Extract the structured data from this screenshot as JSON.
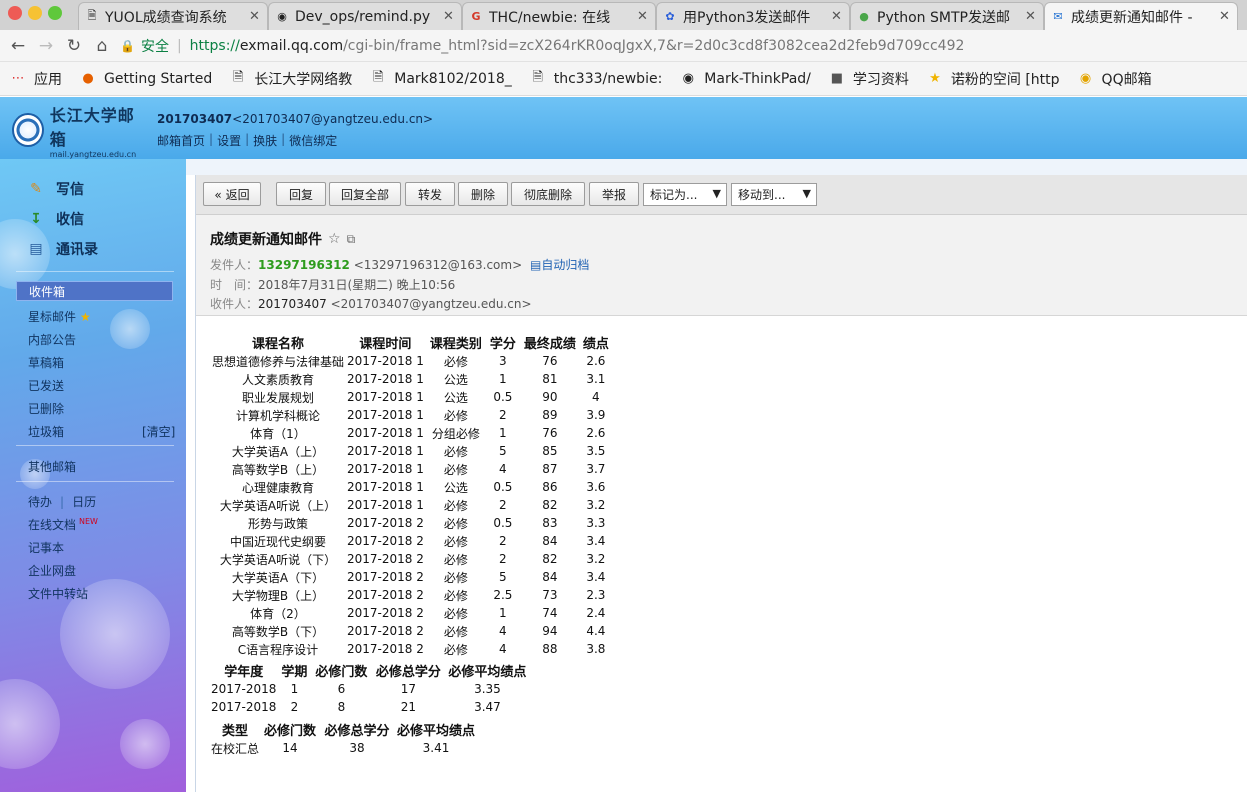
{
  "browser": {
    "tabs": [
      {
        "icon": "page-icon",
        "title": "YUOL成绩查询系统"
      },
      {
        "icon": "github-icon",
        "title": "Dev_ops/remind.py"
      },
      {
        "icon": "g-icon",
        "title": "THC/newbie: 在线"
      },
      {
        "icon": "paw-icon",
        "title": "用Python3发送邮件"
      },
      {
        "icon": "chat-icon",
        "title": "Python SMTP发送邮"
      },
      {
        "icon": "mail-icon",
        "title": "成绩更新通知邮件 -"
      }
    ],
    "address": {
      "secure_label": "安全",
      "scheme": "https://",
      "host": "exmail.qq.com",
      "path": "/cgi-bin/frame_html?sid=zcX264rKR0oqJgxX,7&r=2d0c3cd8f3082cea2d2feb9d709cc492"
    },
    "bookmarks": [
      {
        "icon": "apps-icon",
        "label": "应用"
      },
      {
        "icon": "firefox-icon",
        "label": "Getting Started"
      },
      {
        "icon": "page-icon",
        "label": "长江大学网络教"
      },
      {
        "icon": "page-icon",
        "label": "Mark8102/2018_"
      },
      {
        "icon": "page-icon",
        "label": "thc333/newbie:"
      },
      {
        "icon": "github-icon",
        "label": "Mark-ThinkPad/"
      },
      {
        "icon": "folder-icon",
        "label": "学习资料"
      },
      {
        "icon": "star-icon",
        "label": "诺粉的空间 [http"
      },
      {
        "icon": "qqmail-icon",
        "label": "QQ邮箱"
      }
    ]
  },
  "header": {
    "logo_cn": "长江大学邮箱",
    "logo_en": "mail.yangtzeu.edu.cn",
    "user_name": "201703407",
    "user_email": "<201703407@yangtzeu.edu.cn>",
    "links": [
      "邮箱首页",
      "设置",
      "换肤",
      "微信绑定"
    ]
  },
  "sidebar": {
    "write": "写信",
    "receive": "收信",
    "contacts": "通讯录",
    "folders": {
      "inbox": "收件箱",
      "starred": "星标邮件",
      "notice": "内部公告",
      "drafts": "草稿箱",
      "sent": "已发送",
      "deleted": "已删除",
      "junk": "垃圾箱",
      "clear": "[清空]",
      "other": "其他邮箱",
      "todo": "待办",
      "calendar": "日历",
      "docs": "在线文档",
      "docs_badge": "NEW",
      "notes": "记事本",
      "disk": "企业网盘",
      "transfer": "文件中转站"
    }
  },
  "toolbar": {
    "back": "« 返回",
    "reply": "回复",
    "reply_all": "回复全部",
    "forward": "转发",
    "delete": "删除",
    "delete_perm": "彻底删除",
    "report": "举报",
    "mark_as": "标记为...",
    "move_to": "移动到..."
  },
  "mail": {
    "subject": "成绩更新通知邮件",
    "from_label": "发件人：",
    "from_name": "13297196312",
    "from_addr": "<13297196312@163.com>",
    "archive": "自动归档",
    "time_label": "时　间：",
    "time_value": "2018年7月31日(星期二) 晚上10:56",
    "to_label": "收件人：",
    "to_name": "201703407",
    "to_addr": "<201703407@yangtzeu.edu.cn>"
  },
  "grades": {
    "headers": [
      "课程名称",
      "课程时间",
      "课程类别",
      "学分",
      "最终成绩",
      "绩点"
    ],
    "rows": [
      [
        "思想道德修养与法律基础",
        "2017-2018 1",
        "必修",
        "3",
        "76",
        "2.6"
      ],
      [
        "人文素质教育",
        "2017-2018 1",
        "公选",
        "1",
        "81",
        "3.1"
      ],
      [
        "职业发展规划",
        "2017-2018 1",
        "公选",
        "0.5",
        "90",
        "4"
      ],
      [
        "计算机学科概论",
        "2017-2018 1",
        "必修",
        "2",
        "89",
        "3.9"
      ],
      [
        "体育（1）",
        "2017-2018 1",
        "分组必修",
        "1",
        "76",
        "2.6"
      ],
      [
        "大学英语A（上）",
        "2017-2018 1",
        "必修",
        "5",
        "85",
        "3.5"
      ],
      [
        "高等数学B（上）",
        "2017-2018 1",
        "必修",
        "4",
        "87",
        "3.7"
      ],
      [
        "心理健康教育",
        "2017-2018 1",
        "公选",
        "0.5",
        "86",
        "3.6"
      ],
      [
        "大学英语A听说（上）",
        "2017-2018 1",
        "必修",
        "2",
        "82",
        "3.2"
      ],
      [
        "形势与政策",
        "2017-2018 2",
        "必修",
        "0.5",
        "83",
        "3.3"
      ],
      [
        "中国近现代史纲要",
        "2017-2018 2",
        "必修",
        "2",
        "84",
        "3.4"
      ],
      [
        "大学英语A听说（下）",
        "2017-2018 2",
        "必修",
        "2",
        "82",
        "3.2"
      ],
      [
        "大学英语A（下）",
        "2017-2018 2",
        "必修",
        "5",
        "84",
        "3.4"
      ],
      [
        "大学物理B（上）",
        "2017-2018 2",
        "必修",
        "2.5",
        "73",
        "2.3"
      ],
      [
        "体育（2）",
        "2017-2018 2",
        "必修",
        "1",
        "74",
        "2.4"
      ],
      [
        "高等数学B（下）",
        "2017-2018 2",
        "必修",
        "4",
        "94",
        "4.4"
      ],
      [
        "C语言程序设计",
        "2017-2018 2",
        "必修",
        "4",
        "88",
        "3.8"
      ]
    ]
  },
  "terms": {
    "headers": [
      "学年度",
      "学期",
      "必修门数",
      "必修总学分",
      "必修平均绩点"
    ],
    "rows": [
      [
        "2017-2018",
        "1",
        "6",
        "17",
        "3.35"
      ],
      [
        "2017-2018",
        "2",
        "8",
        "21",
        "3.47"
      ]
    ]
  },
  "totals": {
    "headers": [
      "类型",
      "必修门数",
      "必修总学分",
      "必修平均绩点"
    ],
    "rows": [
      [
        "在校汇总",
        "14",
        "38",
        "3.41"
      ]
    ]
  }
}
